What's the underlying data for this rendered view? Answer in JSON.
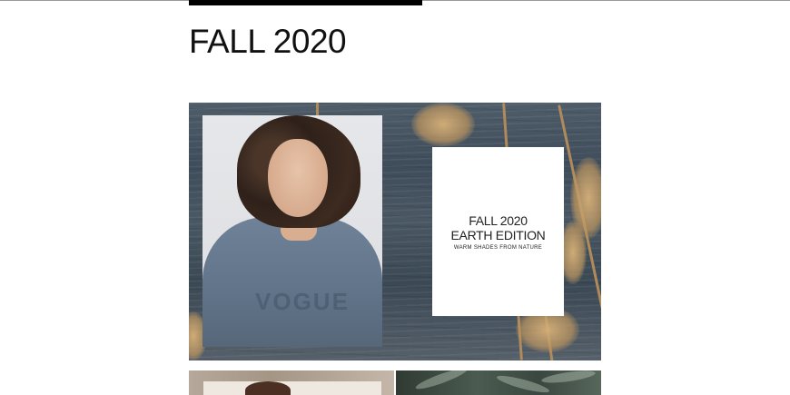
{
  "page": {
    "title": "FALL 2020"
  },
  "hero": {
    "photo_alt": "Model with curly hair wearing a blue sweatshirt",
    "sweater_print": "VOGUE",
    "promo": {
      "line1": "FALL 2020",
      "line2": "EARTH EDITION",
      "tagline": "WARM SHADES FROM NATURE"
    }
  },
  "colors": {
    "tab_indicator": "#000000",
    "title_text": "#111111"
  },
  "icons": []
}
